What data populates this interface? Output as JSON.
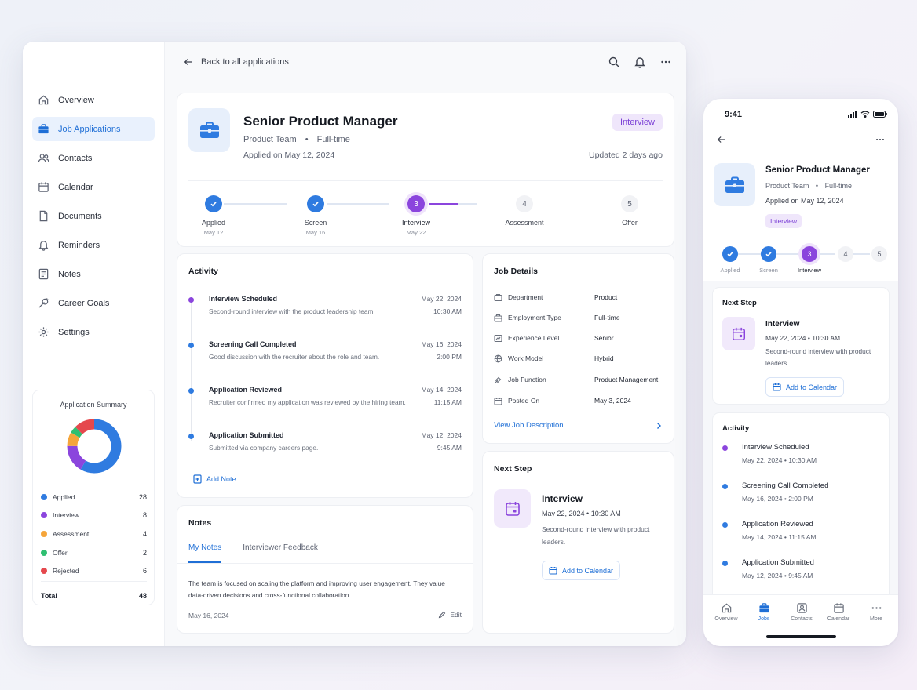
{
  "sidebar": {
    "items": [
      {
        "label": "Overview",
        "icon": "home-icon"
      },
      {
        "label": "Job Applications",
        "icon": "briefcase-icon",
        "active": true
      },
      {
        "label": "Contacts",
        "icon": "users-icon"
      },
      {
        "label": "Calendar",
        "icon": "calendar-icon"
      },
      {
        "label": "Documents",
        "icon": "document-icon"
      },
      {
        "label": "Reminders",
        "icon": "bell-icon"
      },
      {
        "label": "Notes",
        "icon": "notes-icon"
      },
      {
        "label": "Career Goals",
        "icon": "target-icon"
      },
      {
        "label": "Settings",
        "icon": "gear-icon"
      }
    ],
    "summary": {
      "title": "Application Summary",
      "rows": [
        {
          "label": "Applied",
          "count": "28",
          "color": "#2f7be0"
        },
        {
          "label": "Interview",
          "count": "8",
          "color": "#8b45dd"
        },
        {
          "label": "Assessment",
          "count": "4",
          "color": "#f5a53a"
        },
        {
          "label": "Offer",
          "count": "2",
          "color": "#2fbf71"
        },
        {
          "label": "Rejected",
          "count": "6",
          "color": "#e5484d"
        }
      ],
      "total_label": "Total",
      "total_value": "48"
    }
  },
  "topbar": {
    "back_label": "Back to all applications"
  },
  "job": {
    "title": "Senior Product Manager",
    "team": "Product Team",
    "type": "Full-time",
    "applied": "Applied on May 12, 2024",
    "status": "Interview",
    "updated": "Updated 2 days ago"
  },
  "steps": [
    {
      "name": "Applied",
      "date": "May 12",
      "state": "done",
      "num": ""
    },
    {
      "name": "Screen",
      "date": "May 16",
      "state": "done",
      "num": ""
    },
    {
      "name": "Interview",
      "date": "May 22",
      "state": "current",
      "num": "3"
    },
    {
      "name": "Assessment",
      "date": "",
      "state": "todo",
      "num": "4"
    },
    {
      "name": "Offer",
      "date": "",
      "state": "todo",
      "num": "5"
    }
  ],
  "activity": {
    "title": "Activity",
    "items": [
      {
        "title": "Interview Scheduled",
        "desc": "Second-round interview with the product leadership team.",
        "date": "May 22, 2024",
        "time": "10:30 AM",
        "color": "#8b45dd"
      },
      {
        "title": "Screening Call Completed",
        "desc": "Good discussion with the recruiter about the role and team.",
        "date": "May 16, 2024",
        "time": "2:00 PM",
        "color": "#2f7be0"
      },
      {
        "title": "Application Reviewed",
        "desc": "Recruiter confirmed my application was reviewed by the hiring team.",
        "date": "May 14, 2024",
        "time": "11:15 AM",
        "color": "#2f7be0"
      },
      {
        "title": "Application Submitted",
        "desc": "Submitted via company careers page.",
        "date": "May 12, 2024",
        "time": "9:45 AM",
        "color": "#2f7be0"
      }
    ],
    "add_note": "Add Note"
  },
  "notes": {
    "title": "Notes",
    "tab_mine": "My Notes",
    "tab_feedback": "Interviewer Feedback",
    "text": "The team is focused on scaling the platform and improving user engagement. They value data-driven decisions and cross-functional collaboration.",
    "date": "May 16, 2024",
    "edit": "Edit"
  },
  "details": {
    "title": "Job Details",
    "rows": [
      {
        "key": "Department",
        "value": "Product"
      },
      {
        "key": "Employment Type",
        "value": "Full-time"
      },
      {
        "key": "Experience Level",
        "value": "Senior"
      },
      {
        "key": "Work Model",
        "value": "Hybrid"
      },
      {
        "key": "Job Function",
        "value": "Product Management"
      },
      {
        "key": "Posted On",
        "value": "May 3, 2024"
      }
    ],
    "view_link": "View Job Description"
  },
  "next_step": {
    "title": "Next Step",
    "event": "Interview",
    "when": "May 22, 2024  •  10:30 AM",
    "desc": "Second-round interview with product leaders.",
    "button": "Add to Calendar"
  },
  "phone": {
    "time": "9:41",
    "badge": "Interview",
    "applied": "Applied on May 12, 2024",
    "activity": [
      {
        "title": "Interview Scheduled",
        "sub": "May 22, 2024  •  10:30 AM",
        "color": "#8b45dd"
      },
      {
        "title": "Screening Call Completed",
        "sub": "May 16, 2024  •  2:00 PM",
        "color": "#2f7be0"
      },
      {
        "title": "Application Reviewed",
        "sub": "May 14, 2024  •  11:15 AM",
        "color": "#2f7be0"
      },
      {
        "title": "Application Submitted",
        "sub": "May 12, 2024  •  9:45 AM",
        "color": "#2f7be0"
      }
    ],
    "tabs": [
      "Overview",
      "Jobs",
      "Contacts",
      "Calendar",
      "More"
    ]
  },
  "colors": {
    "accent": "#1f6fd6",
    "interview": "#8b45dd",
    "done": "#2f7be0"
  }
}
